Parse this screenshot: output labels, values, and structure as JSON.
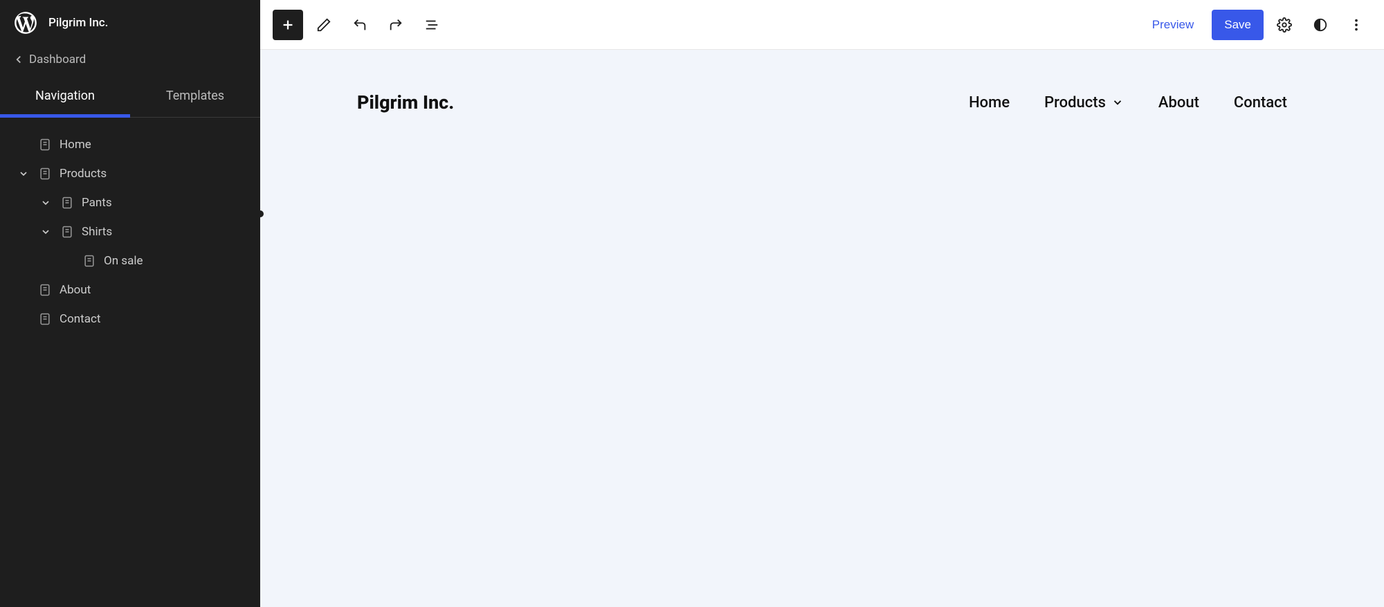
{
  "site": {
    "name": "Pilgrim Inc."
  },
  "sidebar": {
    "dashboard": "Dashboard",
    "tabs": {
      "navigation": "Navigation",
      "templates": "Templates"
    },
    "tree": {
      "home": "Home",
      "products": "Products",
      "pants": "Pants",
      "shirts": "Shirts",
      "on_sale": "On sale",
      "about": "About",
      "contact": "Contact"
    }
  },
  "toolbar": {
    "preview": "Preview",
    "save": "Save"
  },
  "canvas": {
    "site_title": "Pilgrim Inc.",
    "nav": {
      "home": "Home",
      "products": "Products",
      "about": "About",
      "contact": "Contact"
    }
  }
}
